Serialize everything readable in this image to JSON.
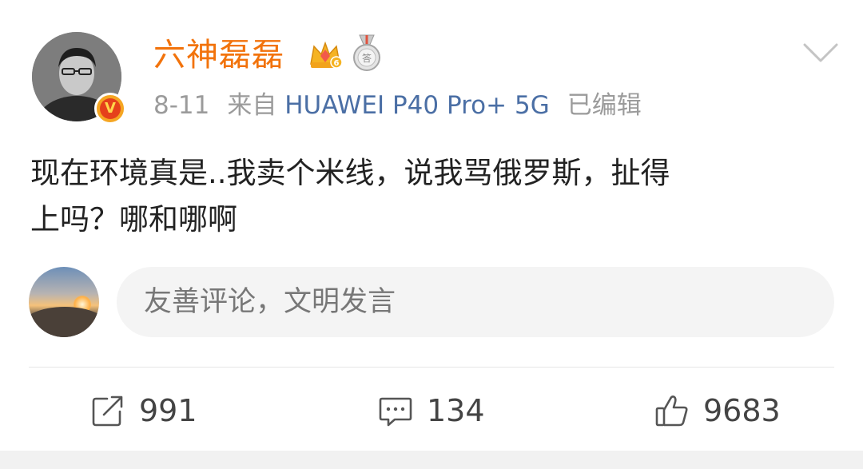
{
  "post": {
    "author": "六神磊磊",
    "meta": {
      "date": "8-11",
      "source_prefix": "来自",
      "device": "HUAWEI P40 Pro+ 5G",
      "edited": "已编辑"
    },
    "content_lines": [
      "现在环境真是..我卖个米线，说我骂俄罗斯，扯得",
      "上吗？哪和哪啊"
    ],
    "comment_placeholder": "友善评论，文明发言",
    "actions": {
      "repost_count": "991",
      "comment_count": "134",
      "like_count": "9683"
    }
  },
  "icons": {
    "verified_badge": "v-badge-icon",
    "crown": "crown-icon",
    "medal": "medal-icon",
    "menu": "chevron-down-icon",
    "repost": "share-icon",
    "comment": "comment-icon",
    "like": "thumbs-up-icon"
  },
  "colors": {
    "username": "#f2730c",
    "device_link": "#4b6fa5",
    "meta_text": "#9b9b9b",
    "body_text": "#222222",
    "badge_gold": "#f5a623",
    "badge_red": "#e5401b"
  }
}
